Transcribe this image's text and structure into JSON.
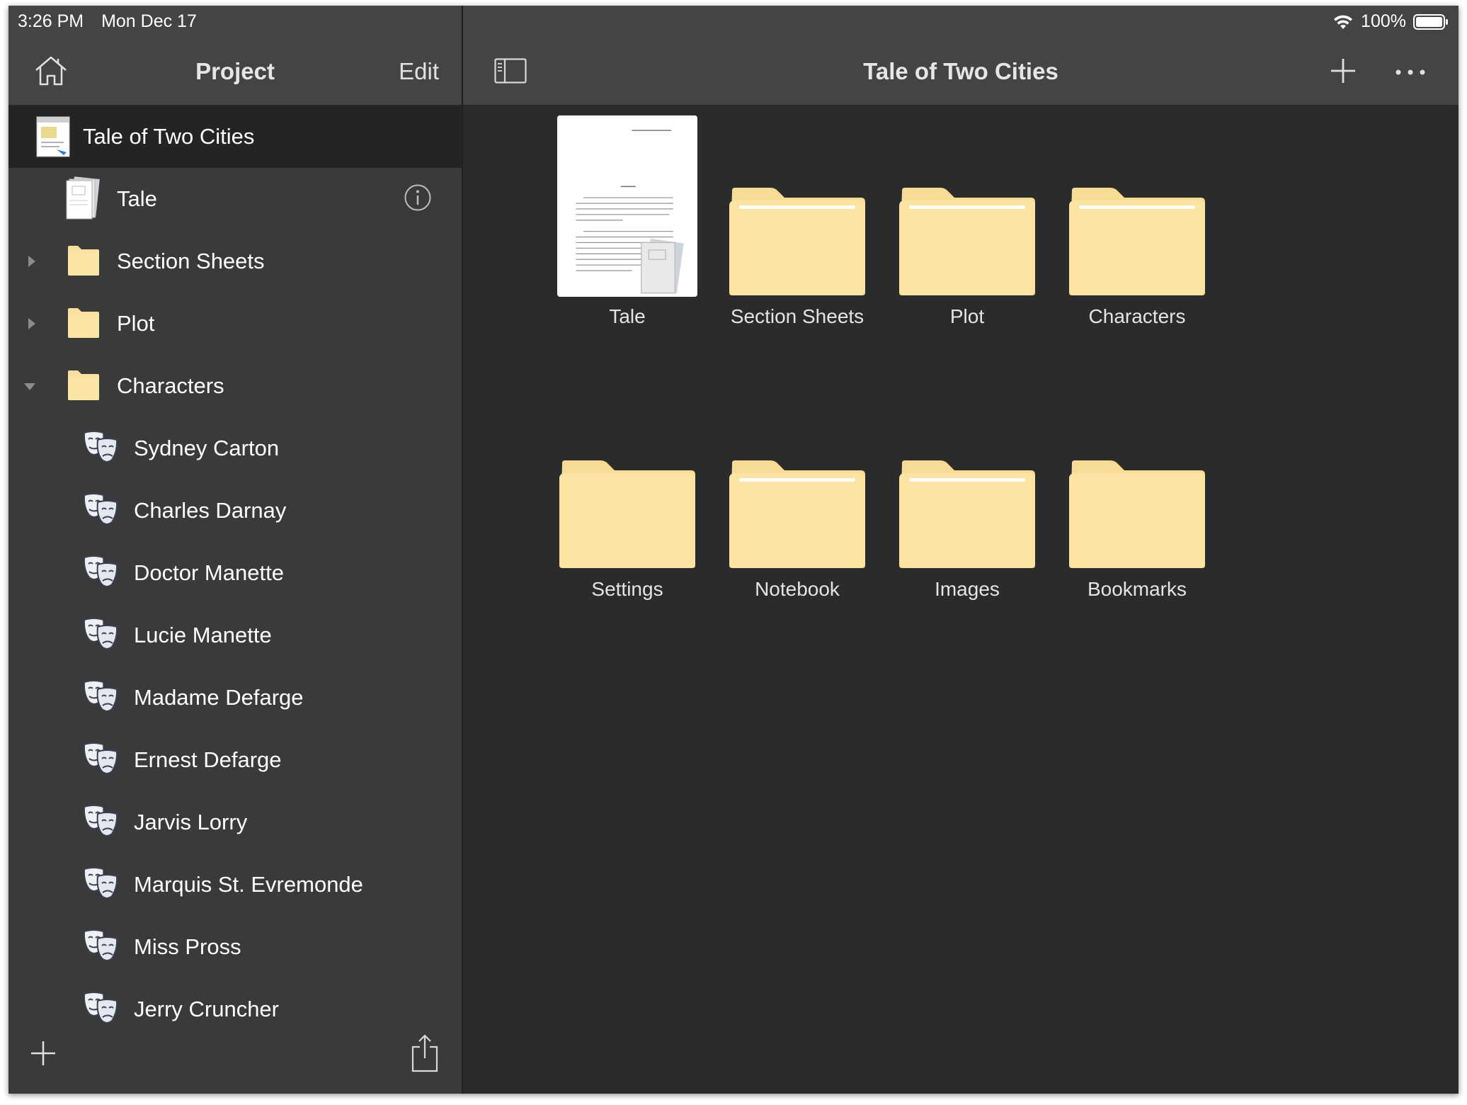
{
  "status_bar": {
    "time": "3:26 PM",
    "date": "Mon Dec 17",
    "battery": "100%"
  },
  "sidebar": {
    "title": "Project",
    "edit_label": "Edit",
    "project": {
      "label": "Tale of Two Cities"
    },
    "items": [
      {
        "label": "Tale",
        "icon": "manuscript-icon",
        "disclosure": "none"
      },
      {
        "label": "Section Sheets",
        "icon": "folder-icon",
        "disclosure": "collapsed"
      },
      {
        "label": "Plot",
        "icon": "folder-icon",
        "disclosure": "collapsed"
      },
      {
        "label": "Characters",
        "icon": "folder-icon",
        "disclosure": "expanded"
      }
    ],
    "characters": [
      "Sydney Carton",
      "Charles Darnay",
      "Doctor Manette",
      "Lucie Manette",
      "Madame Defarge",
      "Ernest Defarge",
      "Jarvis Lorry",
      "Marquis St. Evremonde",
      "Miss Pross",
      "Jerry Cruncher"
    ]
  },
  "main": {
    "title": "Tale of Two Cities",
    "grid": [
      {
        "label": "Tale",
        "type": "document"
      },
      {
        "label": "Section Sheets",
        "type": "folder-with-content"
      },
      {
        "label": "Plot",
        "type": "folder-with-content"
      },
      {
        "label": "Characters",
        "type": "folder-with-content"
      },
      {
        "label": "Settings",
        "type": "folder-empty"
      },
      {
        "label": "Notebook",
        "type": "folder-with-content"
      },
      {
        "label": "Images",
        "type": "folder-with-content"
      },
      {
        "label": "Bookmarks",
        "type": "folder-empty"
      }
    ]
  },
  "colors": {
    "sidebar_bg": "#3a3a3a",
    "nav_bg": "#444444",
    "main_bg": "#2b2b2b",
    "selected_row": "#242424",
    "folder": "#f9e09e"
  }
}
